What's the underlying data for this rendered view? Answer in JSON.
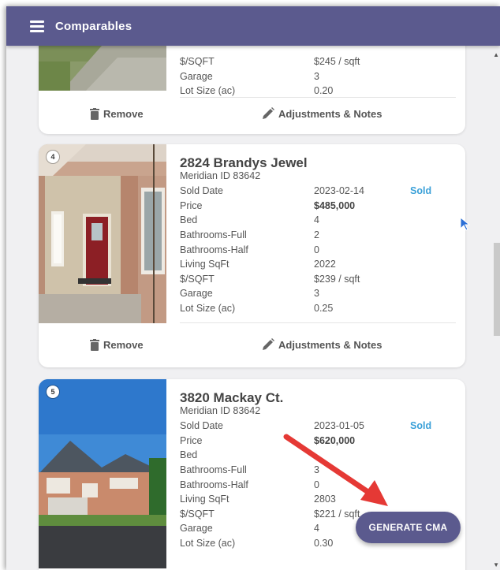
{
  "app": {
    "title": "Comparables"
  },
  "cards": [
    {
      "rows": [
        {
          "label": "$/SQFT",
          "value": "$245 / sqft"
        },
        {
          "label": "Garage",
          "value": "3"
        },
        {
          "label": "Lot Size (ac)",
          "value": "0.20"
        }
      ],
      "remove_label": "Remove",
      "adjust_label": "Adjustments & Notes"
    },
    {
      "index": "4",
      "address": "2824 Brandys Jewel",
      "city": "Meridian ID 83642",
      "status": "Sold",
      "rows": [
        {
          "label": "Sold Date",
          "value": "2023-02-14"
        },
        {
          "label": "Price",
          "value": "$485,000"
        },
        {
          "label": "Bed",
          "value": "4"
        },
        {
          "label": "Bathrooms-Full",
          "value": "2"
        },
        {
          "label": "Bathrooms-Half",
          "value": "0"
        },
        {
          "label": "Living SqFt",
          "value": "2022"
        },
        {
          "label": "$/SQFT",
          "value": "$239 / sqft"
        },
        {
          "label": "Garage",
          "value": "3"
        },
        {
          "label": "Lot Size (ac)",
          "value": "0.25"
        }
      ],
      "remove_label": "Remove",
      "adjust_label": "Adjustments & Notes"
    },
    {
      "index": "5",
      "address": "3820 Mackay Ct.",
      "city": "Meridian ID 83642",
      "status": "Sold",
      "rows": [
        {
          "label": "Sold Date",
          "value": "2023-01-05"
        },
        {
          "label": "Price",
          "value": "$620,000"
        },
        {
          "label": "Bed",
          "value": ""
        },
        {
          "label": "Bathrooms-Full",
          "value": "3"
        },
        {
          "label": "Bathrooms-Half",
          "value": "0"
        },
        {
          "label": "Living SqFt",
          "value": "2803"
        },
        {
          "label": "$/SQFT",
          "value": "$221 / sqft"
        },
        {
          "label": "Garage",
          "value": "4"
        },
        {
          "label": "Lot Size (ac)",
          "value": "0.30"
        }
      ]
    }
  ],
  "cta": {
    "label": "GENERATE CMA"
  },
  "colors": {
    "appbar": "#5b5a8e",
    "status": "#3aa0d8",
    "annotation_arrow": "#e53935"
  },
  "icons": [
    "menu-icon",
    "trash-icon",
    "pencil-icon",
    "cursor-icon"
  ]
}
